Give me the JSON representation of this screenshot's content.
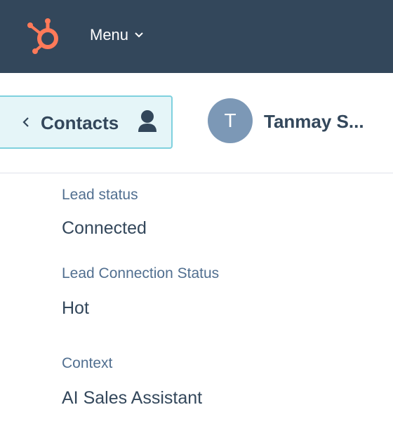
{
  "topbar": {
    "logo": "hubspot-sprocket-logo",
    "menu_label": "Menu",
    "menu_icon": "chevron-down-icon",
    "brand_color": "#ff7a59",
    "background_color": "#33475b"
  },
  "header": {
    "back_button": {
      "label": "Contacts",
      "back_icon": "chevron-left-icon",
      "person_icon": "person-icon"
    },
    "user": {
      "avatar_initial": "T",
      "name": "Tanmay S..."
    }
  },
  "properties": [
    {
      "label": "Lead status",
      "value": "Connected"
    },
    {
      "label": "Lead Connection Status",
      "value": "Hot"
    },
    {
      "label": "Context",
      "value": "AI Sales Assistant"
    }
  ]
}
